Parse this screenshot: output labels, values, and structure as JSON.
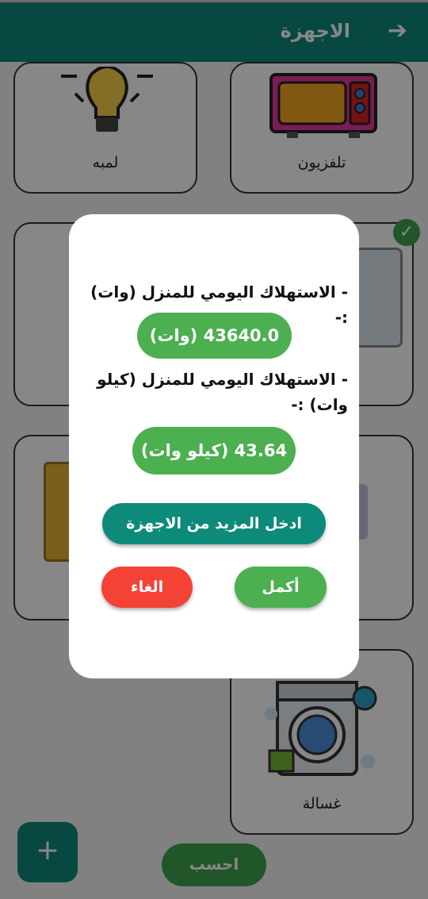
{
  "appbar": {
    "title": "الاجهزة",
    "back_icon": "arrow-right-icon"
  },
  "devices": [
    {
      "label": "تلفزيون",
      "icon": "tv-icon"
    },
    {
      "label": "لمبه",
      "icon": "bulb-icon"
    },
    {
      "label": "",
      "icon": "appliance-icon",
      "selected": true
    },
    {
      "label": "",
      "icon": "appliance-icon"
    },
    {
      "label": "",
      "icon": "appliance-icon"
    },
    {
      "label": "",
      "icon": "fridge-icon"
    },
    {
      "label": "غسالة",
      "icon": "washing-machine-icon"
    }
  ],
  "fab": {
    "label": "+"
  },
  "calculate_button": {
    "label": "احسب"
  },
  "dialog": {
    "daily_watt_label": "- الاستهلاك اليومي للمنزل (وات) :-",
    "daily_watt_value": "43640.0 (وات)",
    "daily_kw_label": "- الاستهلاك اليومي للمنزل (كيلو وات) :-",
    "daily_kw_value": "43.64 (كيلو وات)",
    "add_more_button": "ادخل المزيد من الاجهزة",
    "continue_button": "أكمل",
    "cancel_button": "الغاء"
  },
  "colors": {
    "primary": "#0e8a7b",
    "success": "#4caf50",
    "danger": "#f44336"
  }
}
